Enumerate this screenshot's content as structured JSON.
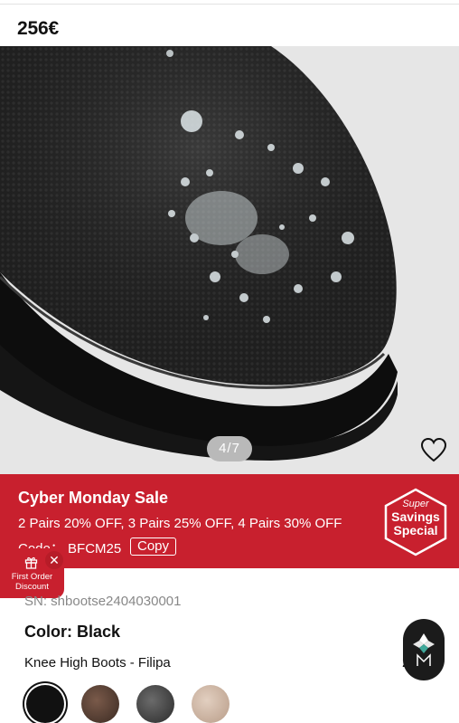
{
  "header": {
    "price": "256€"
  },
  "gallery": {
    "image_alt": "Black knit boot toe with water droplets",
    "counter": "4/7"
  },
  "promo": {
    "title": "Cyber Monday Sale",
    "offer": "2 Pairs 20% OFF, 3 Pairs 25% OFF, 4 Pairs 30% OFF",
    "code_label": "Code： BFCM25",
    "copy_label": "Copy",
    "badge_line1": "Super",
    "badge_line2": "Savings",
    "badge_line3": "Special"
  },
  "first_order": {
    "line1": "First Order",
    "line2": "Discount",
    "close": "✕"
  },
  "product": {
    "sn": "SN: shbootse2404030001",
    "color": "Color: Black",
    "name": "Knee High Boots - Filipa",
    "trailing": "2"
  },
  "swatches": [
    "black",
    "brown",
    "grey",
    "beige"
  ],
  "colors": {
    "accent": "#c8202e",
    "counter_bg": "#b9b9b9",
    "logo_bg": "#1b1b1b"
  }
}
